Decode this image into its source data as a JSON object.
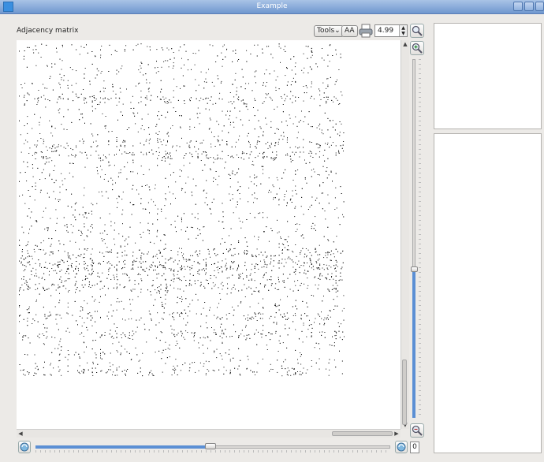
{
  "window": {
    "title": "Example"
  },
  "panel": {
    "label": "Adjacency matrix"
  },
  "toolbar": {
    "tools_label": "Tools",
    "aa_label": "AA",
    "zoom_value": "4.99"
  },
  "slider": {
    "counter": "0"
  },
  "icons": {
    "app": "app-icon",
    "print": "printer-icon",
    "zoom_in": "magnifier-plus-icon",
    "zoom_out": "magnifier-minus-icon",
    "zoom_fit": "magnifier-icon",
    "reset": "refresh-icon"
  },
  "colors": {
    "accent": "#5b8fd4",
    "titlebar": "#6f97cf",
    "dot": "#111111"
  }
}
